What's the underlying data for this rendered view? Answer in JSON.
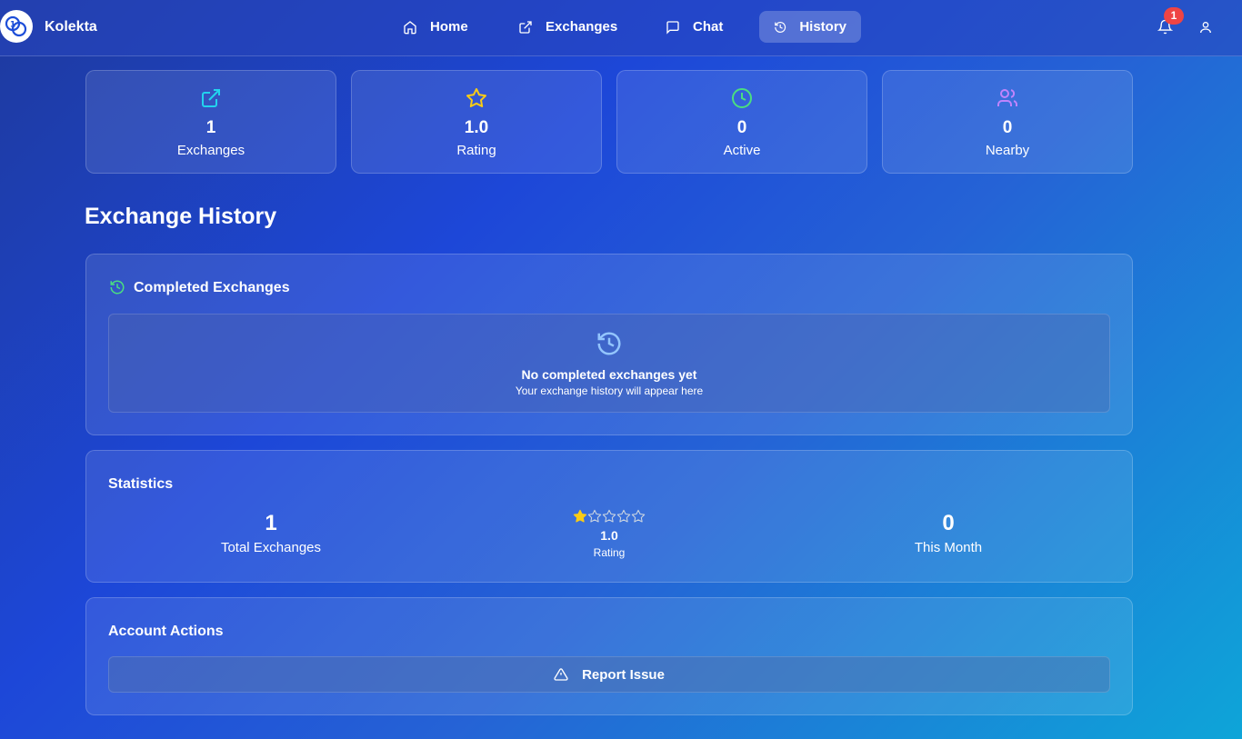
{
  "app": {
    "brand": "Kolekta"
  },
  "nav": {
    "items": [
      {
        "label": "Home",
        "icon": "home-icon"
      },
      {
        "label": "Exchanges",
        "icon": "external-link-icon"
      },
      {
        "label": "Chat",
        "icon": "message-square-icon"
      },
      {
        "label": "History",
        "icon": "history-icon",
        "active": true
      }
    ],
    "notification_count": "1"
  },
  "stats_cards": [
    {
      "value": "1",
      "label": "Exchanges",
      "icon": "external-link-icon",
      "color": "#22d3ee"
    },
    {
      "value": "1.0",
      "label": "Rating",
      "icon": "star-icon",
      "color": "#facc15"
    },
    {
      "value": "0",
      "label": "Active",
      "icon": "clock-icon",
      "color": "#4ade80"
    },
    {
      "value": "0",
      "label": "Nearby",
      "icon": "users-icon",
      "color": "#c084fc"
    }
  ],
  "page": {
    "title": "Exchange History"
  },
  "completed": {
    "title": "Completed Exchanges",
    "empty_title": "No completed exchanges yet",
    "empty_subtitle": "Your exchange history will appear here"
  },
  "statistics": {
    "title": "Statistics",
    "total_value": "1",
    "total_label": "Total Exchanges",
    "rating_value": "1.0",
    "rating_label": "Rating",
    "rating_stars": 1,
    "rating_max": 5,
    "month_value": "0",
    "month_label": "This Month"
  },
  "account": {
    "title": "Account Actions",
    "report_label": "Report Issue"
  },
  "colors": {
    "accent_green": "#4ade80",
    "star": "#facc15",
    "badge": "#ef4444"
  }
}
